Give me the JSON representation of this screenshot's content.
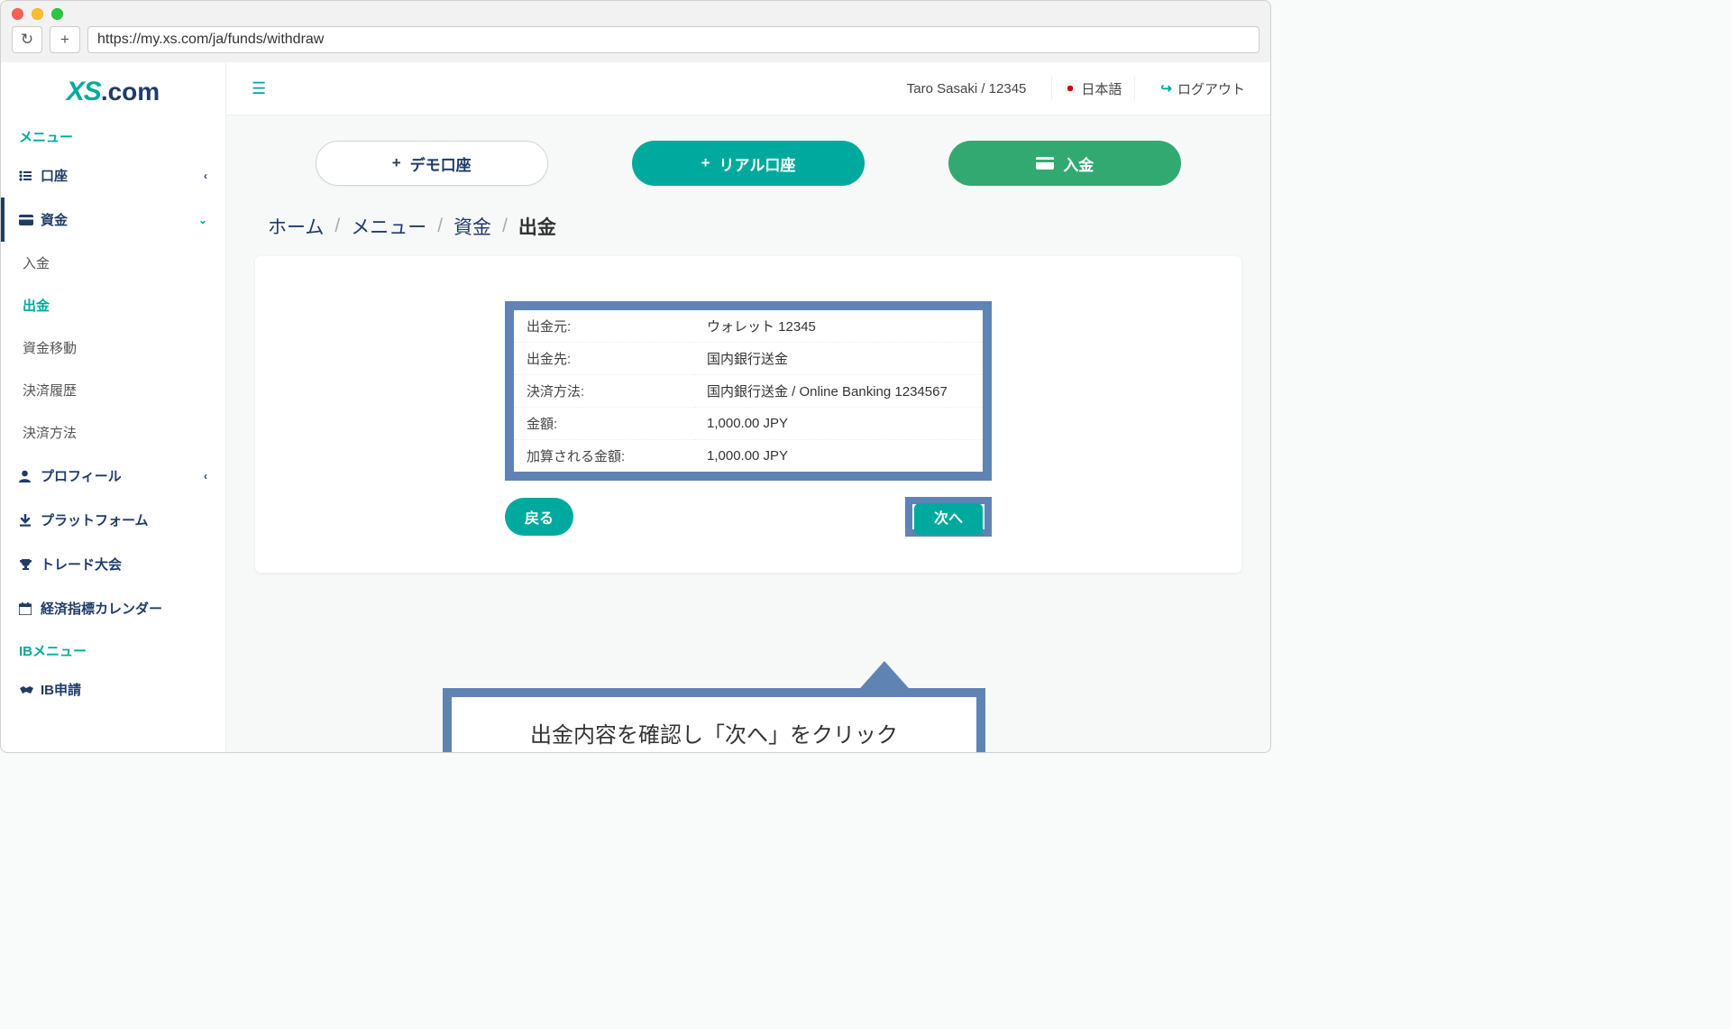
{
  "browser": {
    "url": "https://my.xs.com/ja/funds/withdraw"
  },
  "logo": {
    "xs": "XS",
    "com": ".com"
  },
  "topbar": {
    "user": "Taro Sasaki / 12345",
    "lang": "日本語",
    "logout": "ログアウト"
  },
  "sidebar": {
    "menu_label": "メニュー",
    "accounts": "口座",
    "funds": "資金",
    "sub": {
      "deposit": "入金",
      "withdraw": "出金",
      "transfer": "資金移動",
      "history": "決済履歴",
      "methods": "決済方法"
    },
    "profile": "プロフィール",
    "platform": "プラットフォーム",
    "contest": "トレード大会",
    "calendar": "経済指標カレンダー",
    "ib_menu_label": "IBメニュー",
    "ib_apply": "IB申請"
  },
  "buttons": {
    "demo": "デモ口座",
    "live": "リアル口座",
    "deposit": "入金"
  },
  "breadcrumb": {
    "home": "ホーム",
    "menu": "メニュー",
    "funds": "資金",
    "current": "出金"
  },
  "summary": {
    "source_label": "出金元:",
    "source_value": "ウォレット 12345",
    "dest_label": "出金先:",
    "dest_value": "国内銀行送金",
    "method_label": "決済方法:",
    "method_value": "国内銀行送金 / Online Banking 1234567",
    "amount_label": "金額:",
    "amount_value": "1,000.00 JPY",
    "credit_label": "加算される金額:",
    "credit_value": "1,000.00 JPY"
  },
  "actions": {
    "back": "戻る",
    "next": "次へ"
  },
  "callout": {
    "text": "出金内容を確認し「次へ」をクリック"
  }
}
